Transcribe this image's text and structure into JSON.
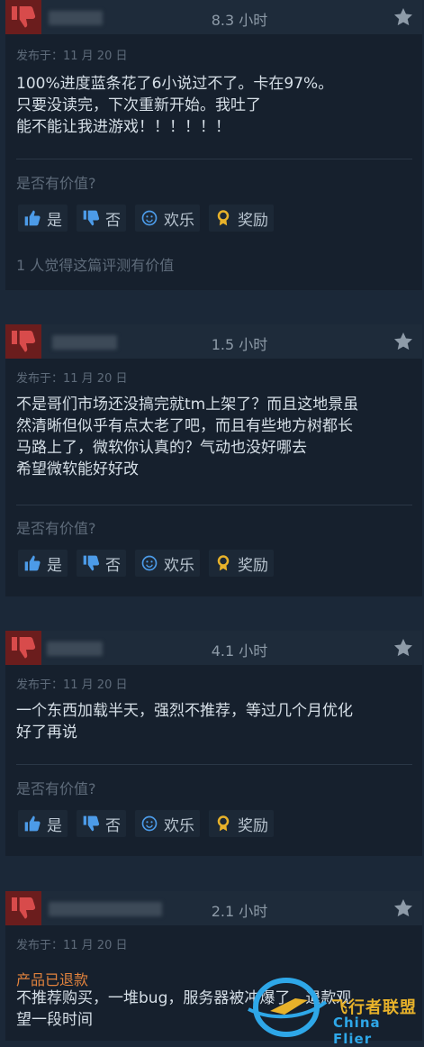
{
  "reviews": [
    {
      "hours": "8.3 小时",
      "date": "发布于：11 月 20 日",
      "refunded": "",
      "text": "100%进度蓝条花了6小说过不了。卡在97%。\n只要没读完，下次重新开始。我吐了\n能不能让我进游戏！！！！！！",
      "helpful_question": "是否有价值?",
      "helpful_count": "1 人觉得这篇评测有价值"
    },
    {
      "hours": "1.5 小时",
      "date": "发布于：11 月 20 日",
      "refunded": "",
      "text": "不是哥们市场还没搞完就tm上架了？而且这地景虽\n然清晰但似乎有点太老了吧，而且有些地方树都长\n马路上了，微软你认真的？气动也没好哪去\n希望微软能好好改",
      "helpful_question": "是否有价值?",
      "helpful_count": ""
    },
    {
      "hours": "4.1 小时",
      "date": "发布于：11 月 20 日",
      "refunded": "",
      "text": "一个东西加载半天，强烈不推荐，等过几个月优化\n好了再说",
      "helpful_question": "是否有价值?",
      "helpful_count": ""
    },
    {
      "hours": "2.1 小时",
      "date": "发布于：11 月 20 日",
      "refunded": "产品已退款",
      "text": "不推荐购买，一堆bug，服务器被冲爆了，退款观\n望一段时间",
      "helpful_question": "",
      "helpful_count": ""
    }
  ],
  "vote_labels": {
    "yes": "是",
    "no": "否",
    "funny": "欢乐",
    "award": "奖励"
  },
  "icons": {
    "recommend": "thumbs-down-icon",
    "star": "star-icon",
    "yes": "thumbs-up-icon",
    "no": "thumbs-down-icon",
    "funny": "smiley-icon",
    "award": "award-icon"
  },
  "colors": {
    "background": "#1b2838",
    "not_recommended": "#6b1d1d",
    "refunded": "#e0823d",
    "award": "#e8b22a"
  },
  "watermark": {
    "text_cn": "飞行者联盟",
    "text_en": "China Flier"
  }
}
